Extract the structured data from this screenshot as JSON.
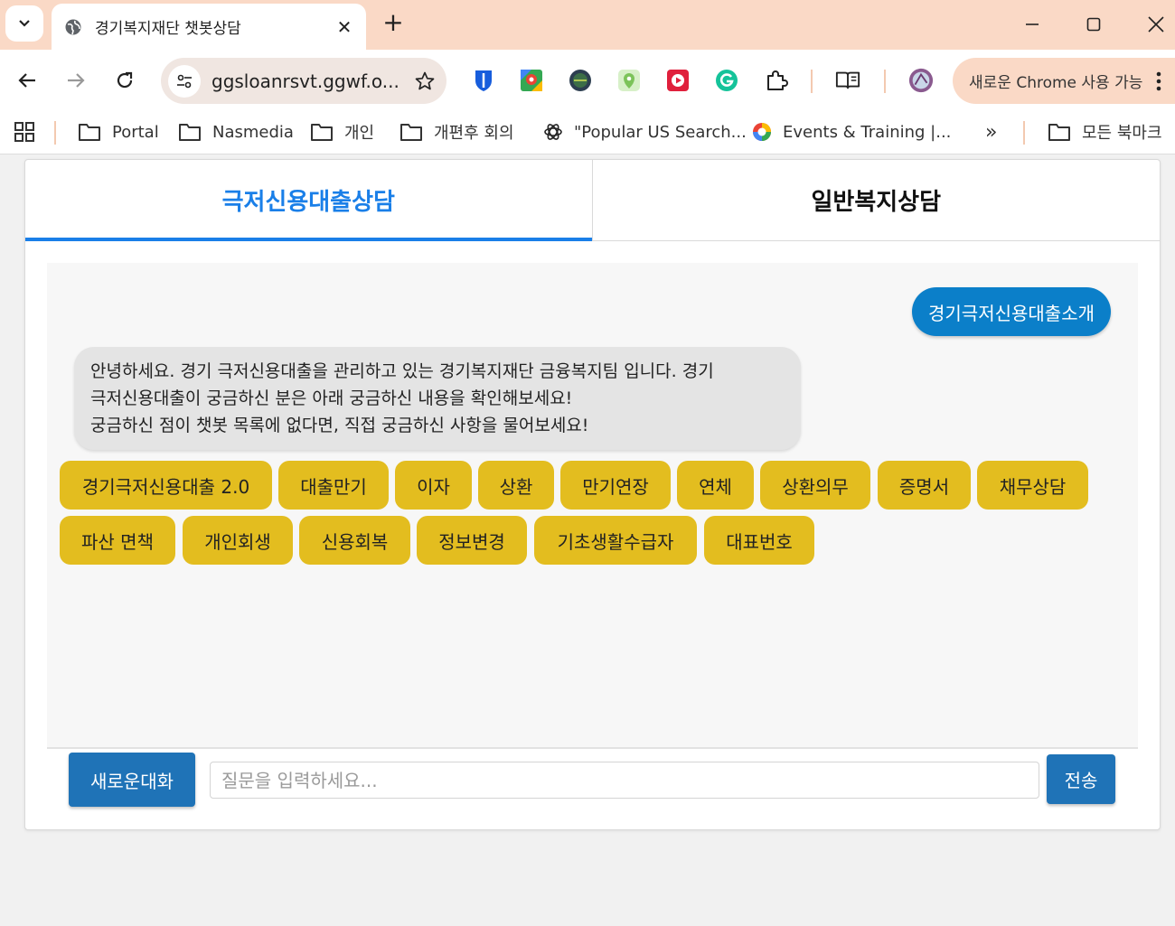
{
  "browser": {
    "tab_title": "경기복지재단 챗봇상담",
    "url": "ggsloanrsvt.ggwf.o...",
    "chrome_update_label": "새로운 Chrome 사용 가능",
    "bookmarks": [
      {
        "label": "Portal",
        "icon": "folder-icon"
      },
      {
        "label": "Nasmedia",
        "icon": "folder-icon"
      },
      {
        "label": "개인",
        "icon": "folder-icon"
      },
      {
        "label": "개편후 회의",
        "icon": "folder-icon"
      },
      {
        "label": "\"Popular US Search...",
        "icon": "openai-icon"
      },
      {
        "label": "Events & Training |...",
        "icon": "google-icon"
      }
    ],
    "overflow_label": "»",
    "all_bookmarks_label": "모든 북마크",
    "extensions": [
      "bitwarden-icon",
      "maps-icon",
      "globe-ext-icon",
      "location-icon",
      "video-icon",
      "grammarly-icon",
      "puzzle-icon",
      "reading-list-icon",
      "profile-avatar"
    ]
  },
  "page": {
    "tabs": [
      {
        "label": "극저신용대출상담",
        "active": true
      },
      {
        "label": "일반복지상담",
        "active": false
      }
    ],
    "user_message": "경기극저신용대출소개",
    "bot_message": [
      "안녕하세요. 경기 극저신용대출을 관리하고 있는 경기복지재단 금융복지팀 입니다. 경기",
      "극저신용대출이 궁금하신 분은 아래 궁금하신 내용을 확인해보세요!",
      "궁금하신 점이 챗봇 목록에 없다면, 직접 궁금하신 사항을 물어보세요!"
    ],
    "quick_buttons": [
      "경기극저신용대출 2.0",
      "대출만기",
      "이자",
      "상환",
      "만기연장",
      "연체",
      "상환의무",
      "증명서",
      "채무상담",
      "파산 면책",
      "개인회생",
      "신용회복",
      "정보변경",
      "기초생활수급자",
      "대표번호"
    ],
    "new_chat_label": "새로운대화",
    "input_placeholder": "질문을 입력하세요...",
    "send_label": "전송"
  },
  "colors": {
    "accent": "#1a7fe8",
    "user_bubble": "#0b7fc9",
    "quick_button": "#e3bd1f",
    "action_button": "#1f73b7"
  }
}
